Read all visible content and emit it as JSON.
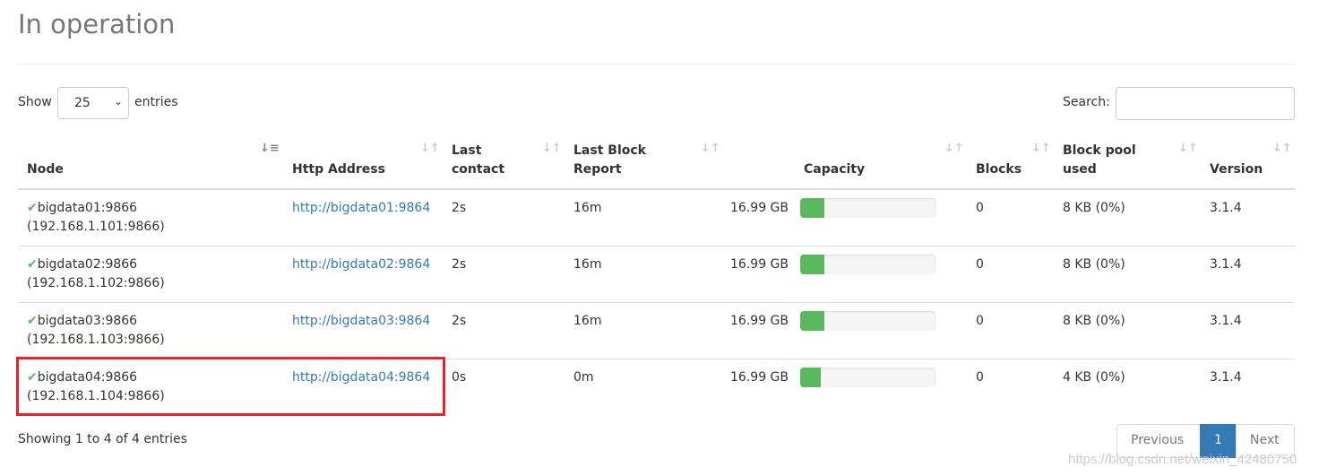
{
  "title": "In operation",
  "length": {
    "show": "Show",
    "value": "25",
    "entries": "entries"
  },
  "search": {
    "label": "Search:",
    "value": ""
  },
  "columns": [
    "Node",
    "Http Address",
    "Last contact",
    "Last Block Report",
    "Capacity",
    "Blocks",
    "Block pool used",
    "Version"
  ],
  "header_lines": {
    "last_contact": [
      "Last",
      "contact"
    ],
    "last_block": [
      "Last Block",
      "Report"
    ],
    "block_pool": [
      "Block pool",
      "used"
    ]
  },
  "rows": [
    {
      "node": "bigdata01:9866",
      "ip": "(192.168.1.101:9866)",
      "http": "http://bigdata01:9864",
      "last_contact": "2s",
      "last_block": "16m",
      "capacity": "16.99 GB",
      "used_pct": 18,
      "blocks": "0",
      "pool": "8 KB (0%)",
      "version": "3.1.4"
    },
    {
      "node": "bigdata02:9866",
      "ip": "(192.168.1.102:9866)",
      "http": "http://bigdata02:9864",
      "last_contact": "2s",
      "last_block": "16m",
      "capacity": "16.99 GB",
      "used_pct": 18,
      "blocks": "0",
      "pool": "8 KB (0%)",
      "version": "3.1.4"
    },
    {
      "node": "bigdata03:9866",
      "ip": "(192.168.1.103:9866)",
      "http": "http://bigdata03:9864",
      "last_contact": "2s",
      "last_block": "16m",
      "capacity": "16.99 GB",
      "used_pct": 18,
      "blocks": "0",
      "pool": "8 KB (0%)",
      "version": "3.1.4"
    },
    {
      "node": "bigdata04:9866",
      "ip": "(192.168.1.104:9866)",
      "http": "http://bigdata04:9864",
      "last_contact": "0s",
      "last_block": "0m",
      "capacity": "16.99 GB",
      "used_pct": 15,
      "blocks": "0",
      "pool": "4 KB (0%)",
      "version": "3.1.4"
    }
  ],
  "info": "Showing 1 to 4 of 4 entries",
  "pagination": {
    "previous": "Previous",
    "page": "1",
    "next": "Next"
  },
  "colors": {
    "accent": "#337ab7",
    "success": "#5cb85c",
    "highlight": "#e8202a"
  },
  "watermark": "https://blog.csdn.net/weixin_42480750"
}
